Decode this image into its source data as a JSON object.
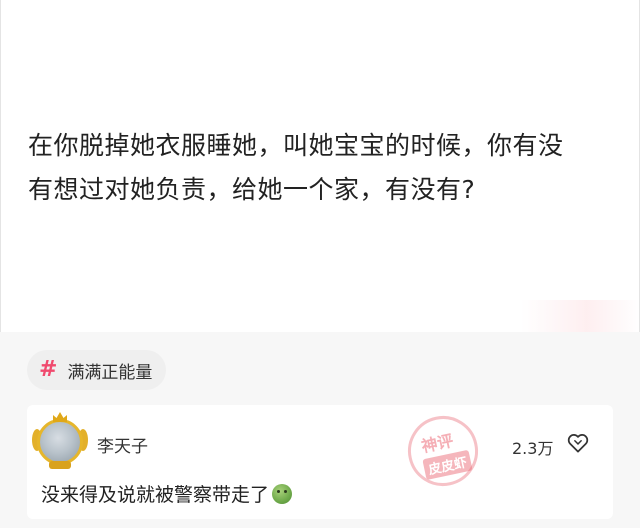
{
  "post": {
    "text_line_1": "在你脱掉她衣服睡她，叫她宝宝的时候，你有没",
    "text_line_2": "有想过对她负责，给她一个家，有没有?"
  },
  "topic": {
    "symbol": "#",
    "label": "满满正能量"
  },
  "comment": {
    "username": "李天子",
    "text": "没来得及说就被警察带走了",
    "emoji": "nauseated-face",
    "likes": "2.3万",
    "like_icon": "heart-outline-icon"
  },
  "watermark": {
    "top": "神评",
    "bottom": "皮皮虾"
  },
  "colors": {
    "topic_accent": "#f04a6e",
    "avatar_frame": "#e6b62b",
    "watermark": "#ec6e7a"
  }
}
